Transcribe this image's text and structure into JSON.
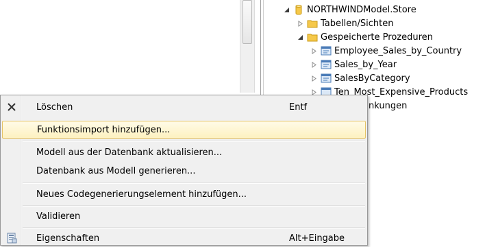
{
  "tree": {
    "items": [
      {
        "label": "NORTHWINDModel.Store",
        "expanded": true
      },
      {
        "label": "Tabellen/Sichten",
        "expanded": false
      },
      {
        "label": "Gespeicherte Prozeduren",
        "expanded": true
      },
      {
        "label": "Employee_Sales_by_Country",
        "expanded": false
      },
      {
        "label": "Sales_by_Year",
        "expanded": false
      },
      {
        "label": "SalesByCategory",
        "expanded": false
      },
      {
        "label": "Ten_Most_Expensive_Products",
        "expanded": false
      },
      {
        "label": "Einschränkungen",
        "visible_text": "änkungen"
      }
    ]
  },
  "context_menu": {
    "items": [
      {
        "label": "Löschen",
        "shortcut": "Entf",
        "icon": "delete-x-icon"
      },
      {
        "label": "Funktionsimport hinzufügen...",
        "shortcut": "",
        "highlighted": true
      },
      {
        "label": "Modell aus der Datenbank aktualisieren...",
        "shortcut": ""
      },
      {
        "label": "Datenbank aus Modell generieren...",
        "shortcut": ""
      },
      {
        "label": "Neues Codegenerierungselement hinzufügen...",
        "shortcut": ""
      },
      {
        "label": "Validieren",
        "shortcut": ""
      },
      {
        "label": "Eigenschaften",
        "shortcut": "Alt+Eingabe",
        "icon": "properties-icon"
      }
    ]
  },
  "colors": {
    "highlight_border": "#e5c365",
    "highlight_fill": "#fdf1c0",
    "menu_bg": "#f0f0f0",
    "folder": "#f5c84a"
  }
}
